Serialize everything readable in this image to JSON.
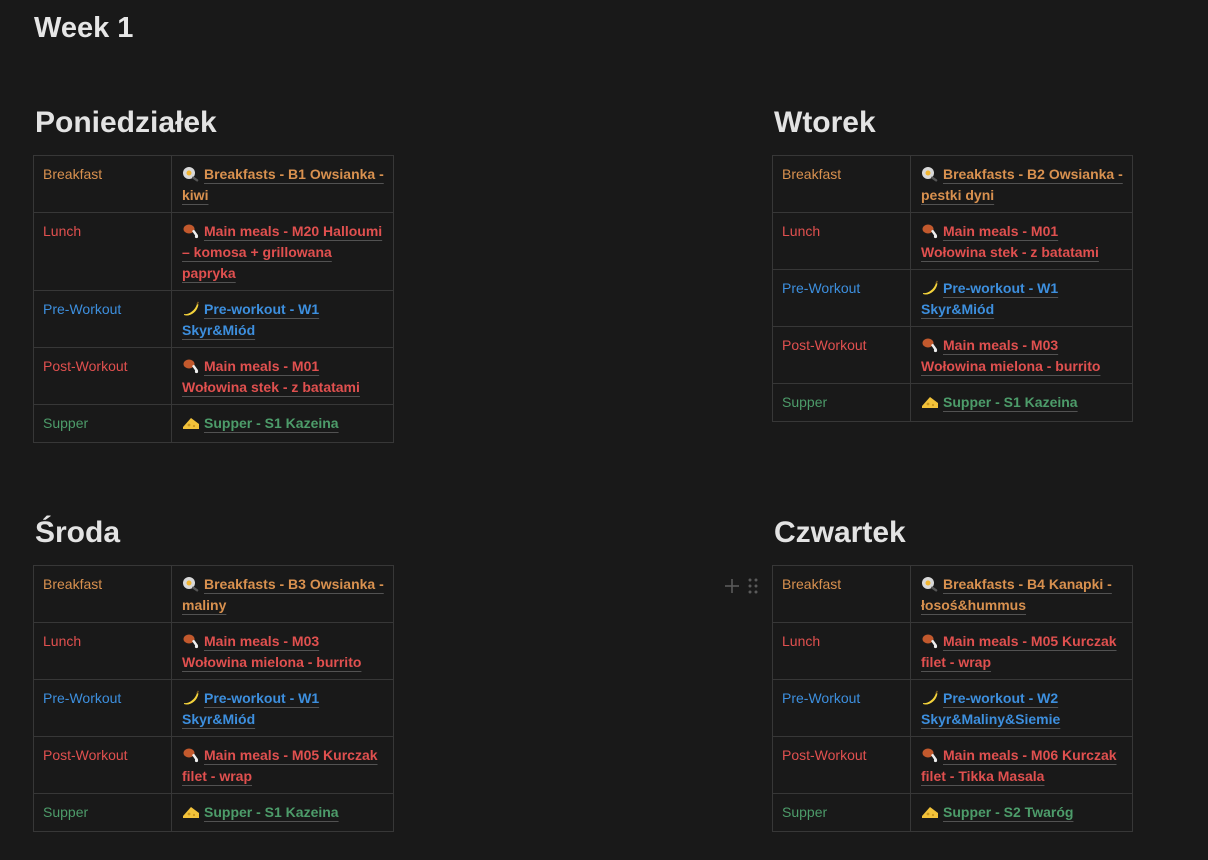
{
  "page": {
    "title": "Week 1"
  },
  "colors": {
    "breakfast": "#d9914f",
    "lunch": "#e0504f",
    "pre_workout": "#3d8fde",
    "post_workout": "#e0504f",
    "supper": "#4d9c6a",
    "background": "#191919"
  },
  "days": [
    {
      "heading": "Poniedziałek",
      "rows": [
        {
          "label": "Breakfast",
          "icon": "egg-pan-icon",
          "value": "Breakfasts - B1 Owsianka - kiwi"
        },
        {
          "label": "Lunch",
          "icon": "meat-drumstick-icon",
          "value": "Main meals - M20 Halloumi – komosa + grillowana papryka"
        },
        {
          "label": "Pre-Workout",
          "icon": "banana-icon",
          "value": "Pre-workout - W1 Skyr&Miód"
        },
        {
          "label": "Post-Workout",
          "icon": "meat-drumstick-icon",
          "value": "Main meals - M01 Wołowina stek - z batatami"
        },
        {
          "label": "Supper",
          "icon": "cheese-icon",
          "value": "Supper - S1 Kazeina"
        }
      ]
    },
    {
      "heading": "Wtorek",
      "rows": [
        {
          "label": "Breakfast",
          "icon": "egg-pan-icon",
          "value": "Breakfasts - B2 Owsianka - pestki dyni"
        },
        {
          "label": "Lunch",
          "icon": "meat-drumstick-icon",
          "value": "Main meals - M01 Wołowina stek - z batatami"
        },
        {
          "label": "Pre-Workout",
          "icon": "banana-icon",
          "value": "Pre-workout - W1 Skyr&Miód"
        },
        {
          "label": "Post-Workout",
          "icon": "meat-drumstick-icon",
          "value": "Main meals - M03 Wołowina mielona - burrito"
        },
        {
          "label": "Supper",
          "icon": "cheese-icon",
          "value": "Supper - S1 Kazeina"
        }
      ]
    },
    {
      "heading": "Środa",
      "rows": [
        {
          "label": "Breakfast",
          "icon": "egg-pan-icon",
          "value": "Breakfasts - B3 Owsianka - maliny"
        },
        {
          "label": "Lunch",
          "icon": "meat-drumstick-icon",
          "value": "Main meals - M03 Wołowina mielona - burrito"
        },
        {
          "label": "Pre-Workout",
          "icon": "banana-icon",
          "value": "Pre-workout - W1 Skyr&Miód"
        },
        {
          "label": "Post-Workout",
          "icon": "meat-drumstick-icon",
          "value": "Main meals - M05 Kurczak filet - wrap"
        },
        {
          "label": "Supper",
          "icon": "cheese-icon",
          "value": "Supper - S1 Kazeina"
        }
      ]
    },
    {
      "heading": "Czwartek",
      "rows": [
        {
          "label": "Breakfast",
          "icon": "egg-pan-icon",
          "value": "Breakfasts - B4 Kanapki - łosoś&hummus"
        },
        {
          "label": "Lunch",
          "icon": "meat-drumstick-icon",
          "value": "Main meals - M05 Kurczak filet - wrap"
        },
        {
          "label": "Pre-Workout",
          "icon": "banana-icon",
          "value": "Pre-workout - W2 Skyr&Maliny&Siemie"
        },
        {
          "label": "Post-Workout",
          "icon": "meat-drumstick-icon",
          "value": "Main meals - M06 Kurczak filet - Tikka Masala"
        },
        {
          "label": "Supper",
          "icon": "cheese-icon",
          "value": "Supper - S2 Twaróg"
        }
      ]
    }
  ]
}
